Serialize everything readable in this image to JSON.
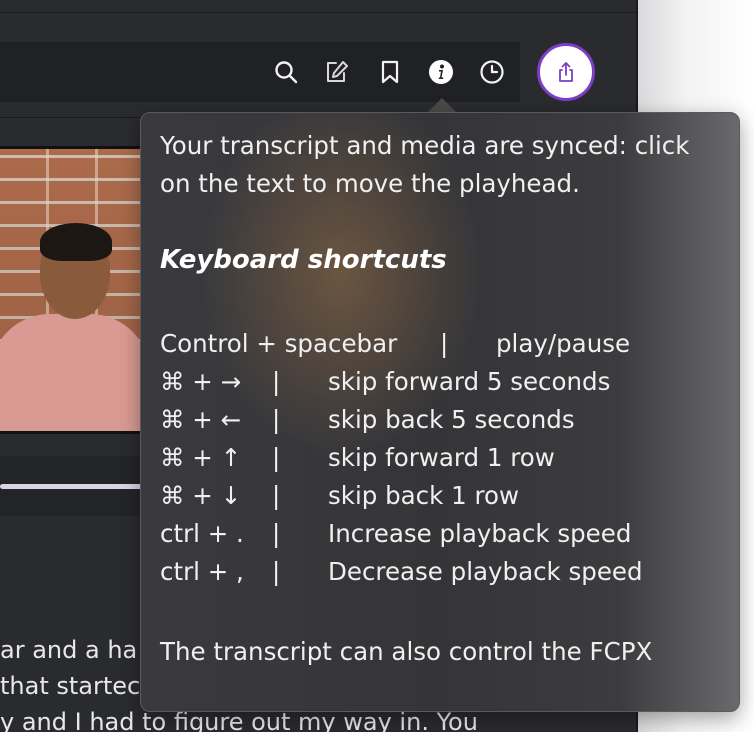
{
  "toolbar": {
    "icons": [
      {
        "name": "search-icon"
      },
      {
        "name": "edit-icon"
      },
      {
        "name": "bookmark-icon"
      },
      {
        "name": "info-icon"
      },
      {
        "name": "clock-icon"
      }
    ],
    "share_icon": "share-icon",
    "accent": "#7b3fc4"
  },
  "transcript": {
    "lines": [
      "ar and a ha",
      "that startec",
      "y and I had to figure out my way in. You"
    ]
  },
  "tooltip": {
    "intro_line1": "Your transcript and media are synced: click",
    "intro_line2": "on the text to move the playhead.",
    "heading": "Keyboard shortcuts",
    "shortcuts": [
      {
        "keys": "Control + spacebar",
        "sep": "|",
        "action": "play/pause"
      },
      {
        "keys": "⌘ + →",
        "sep": "|",
        "action": "skip forward 5 seconds"
      },
      {
        "keys": "⌘ + ←",
        "sep": "|",
        "action": "skip back 5 seconds"
      },
      {
        "keys": "⌘ + ↑",
        "sep": "|",
        "action": "skip forward 1 row"
      },
      {
        "keys": "⌘ + ↓",
        "sep": "|",
        "action": "skip back 1 row"
      },
      {
        "keys": "ctrl + .",
        "sep": "|",
        "action": "Increase playback speed"
      },
      {
        "keys": "ctrl + ,",
        "sep": "|",
        "action": "Decrease playback speed"
      }
    ],
    "footer": "The transcript can also control the FCPX"
  }
}
